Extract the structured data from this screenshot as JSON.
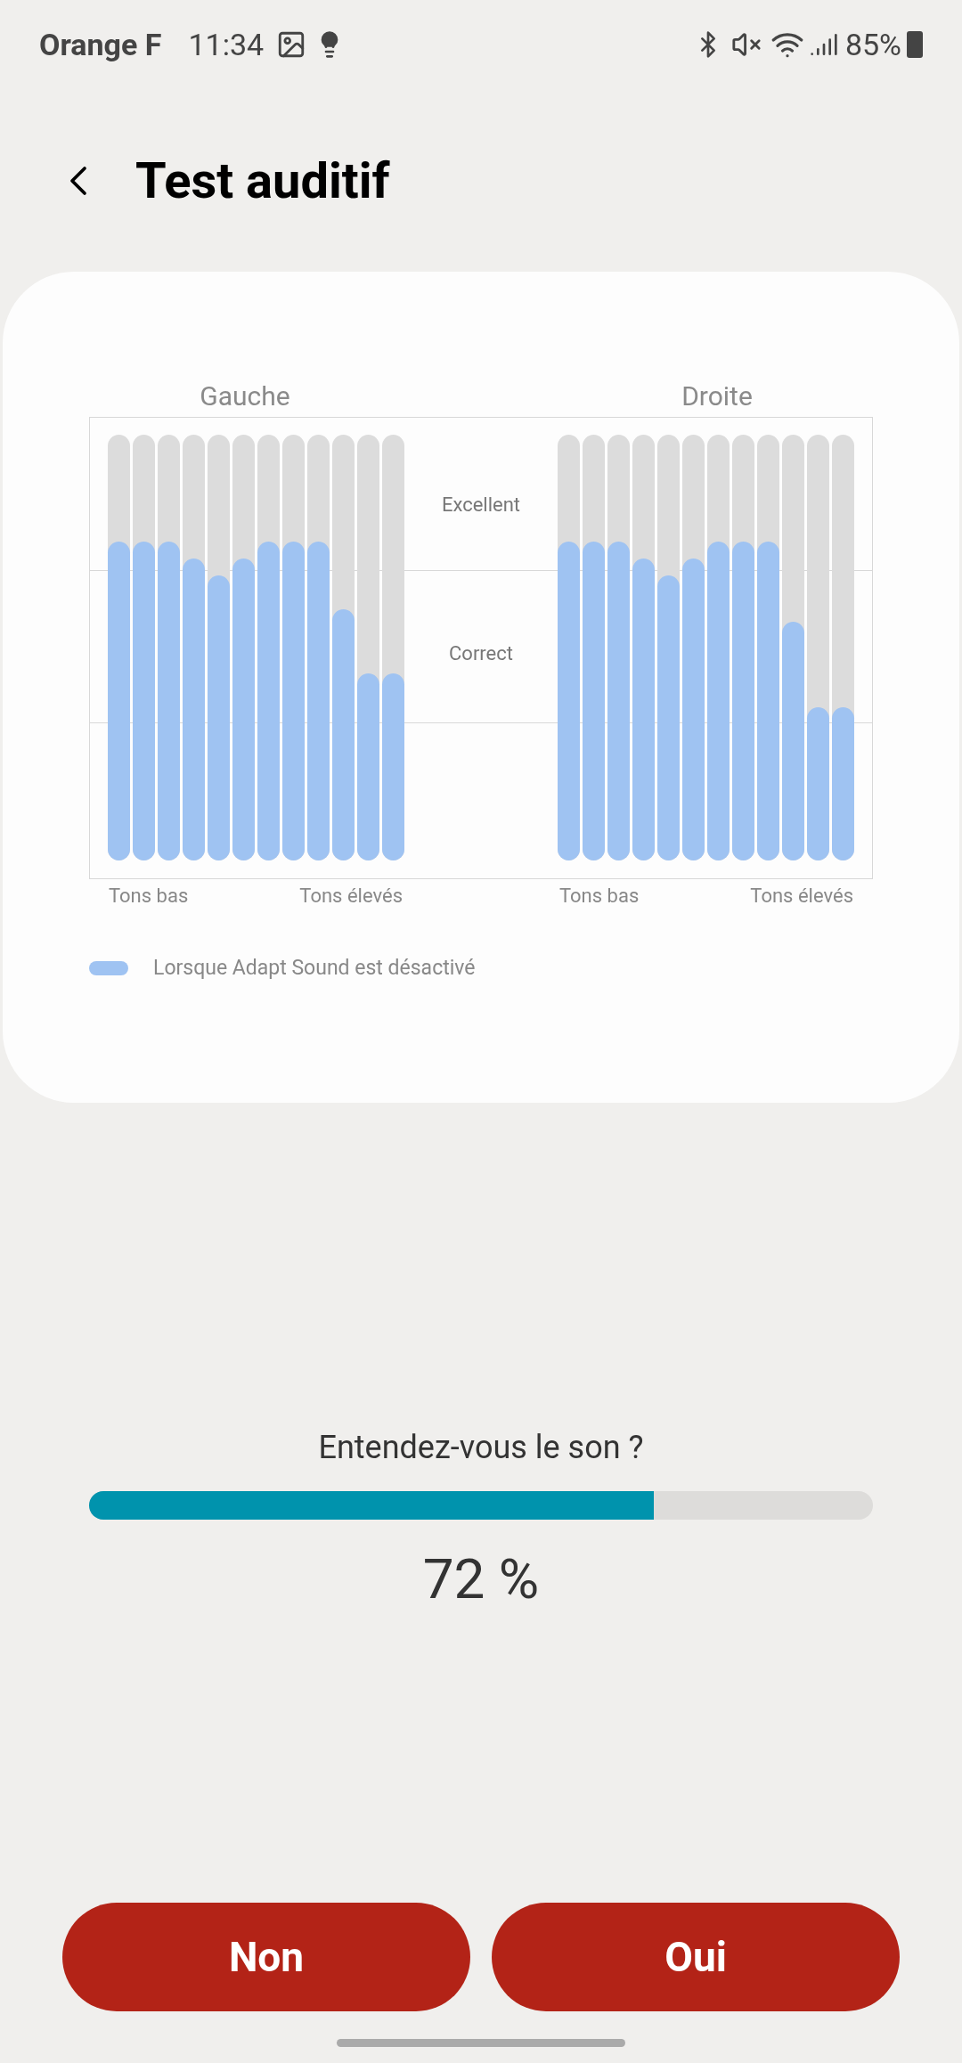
{
  "status_bar": {
    "carrier": "Orange F",
    "time": "11:34",
    "battery": "85%"
  },
  "header": {
    "title": "Test auditif"
  },
  "chart": {
    "left": {
      "label": "Gauche",
      "bars": [
        {
          "level": 0.75
        },
        {
          "level": 0.75
        },
        {
          "level": 0.75
        },
        {
          "level": 0.71
        },
        {
          "level": 0.67
        },
        {
          "level": 0.71
        },
        {
          "level": 0.75
        },
        {
          "level": 0.75
        },
        {
          "level": 0.75
        },
        {
          "level": 0.59
        },
        {
          "level": 0.44
        },
        {
          "level": 0.44
        }
      ],
      "low": "Tons bas",
      "high": "Tons élevés"
    },
    "right": {
      "label": "Droite",
      "bars": [
        {
          "level": 0.75
        },
        {
          "level": 0.75
        },
        {
          "level": 0.75
        },
        {
          "level": 0.71
        },
        {
          "level": 0.67
        },
        {
          "level": 0.71
        },
        {
          "level": 0.75
        },
        {
          "level": 0.75
        },
        {
          "level": 0.75
        },
        {
          "level": 0.56
        },
        {
          "level": 0.36
        },
        {
          "level": 0.36
        }
      ],
      "low": "Tons bas",
      "high": "Tons élevés"
    },
    "bands": [
      "Excellent",
      "Correct"
    ],
    "legend": "Lorsque Adapt Sound est désactivé"
  },
  "question": "Entendez-vous le son ?",
  "progress": {
    "level": 0.72,
    "reading": "72 %"
  },
  "buttons": [
    "Non",
    "Oui"
  ]
}
